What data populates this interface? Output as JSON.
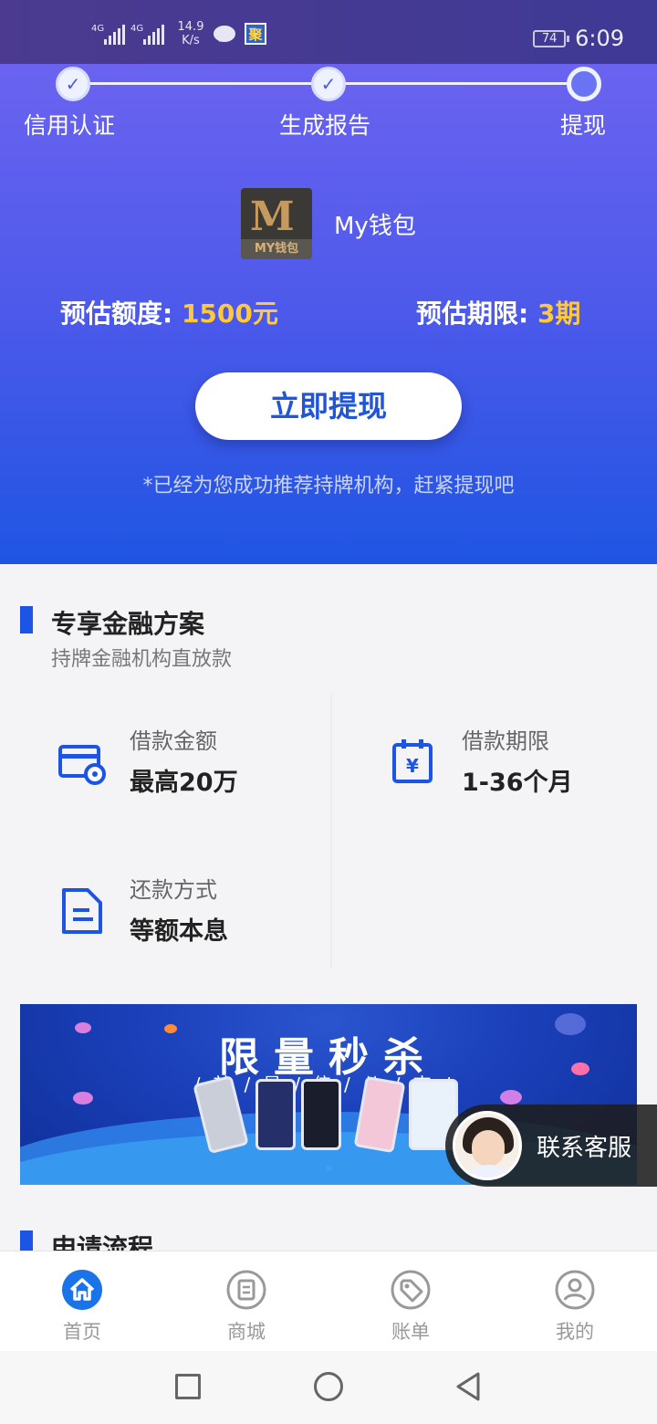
{
  "status_bar": {
    "network1": "4G",
    "network2": "4G",
    "speed_value": "14.9",
    "speed_unit": "K/s",
    "app_badge": "聚",
    "battery": "74",
    "time": "6:09"
  },
  "steps": [
    {
      "label": "信用认证",
      "state": "done"
    },
    {
      "label": "生成报告",
      "state": "done"
    },
    {
      "label": "提现",
      "state": "current"
    }
  ],
  "brand": {
    "logo_text": "MY钱包",
    "name": "My钱包"
  },
  "quota": {
    "amount_label": "预估额度:",
    "amount_value": "1500元",
    "term_label": "预估期限:",
    "term_value": "3期"
  },
  "withdraw_button": "立即提现",
  "hint": "*已经为您成功推荐持牌机构，赶紧提现吧",
  "plan": {
    "title": "专享金融方案",
    "subtitle": "持牌金融机构直放款",
    "features": [
      {
        "label": "借款金额",
        "value": "最高20万",
        "icon": "card-icon"
      },
      {
        "label": "借款期限",
        "value": "1-36个月",
        "icon": "calendar-yuan-icon"
      },
      {
        "label": "还款方式",
        "value": "等额本息",
        "icon": "document-icon"
      }
    ]
  },
  "banner": {
    "title": "限量秒杀",
    "subtitle": "/就/是/倍/儿/爽/"
  },
  "customer_service": "联系客服",
  "apply_section_title": "申请流程",
  "bottom_nav": [
    {
      "label": "首页",
      "icon": "home-icon",
      "active": true
    },
    {
      "label": "商城",
      "icon": "shop-icon",
      "active": false
    },
    {
      "label": "账单",
      "icon": "bill-tag-icon",
      "active": false
    },
    {
      "label": "我的",
      "icon": "profile-icon",
      "active": false
    }
  ],
  "colors": {
    "accent": "#1c55e6",
    "highlight": "#ffc93a",
    "hero_top": "#6b63f0",
    "hero_bottom": "#1f55e3"
  }
}
